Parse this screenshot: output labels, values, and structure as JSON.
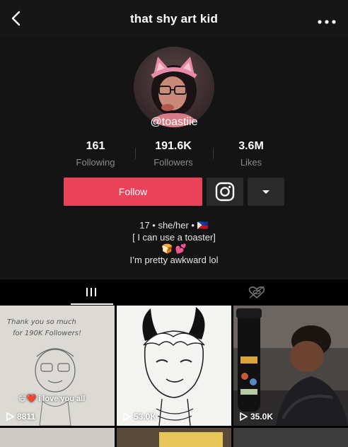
{
  "header": {
    "title": "that shy art kid"
  },
  "profile": {
    "username": "@toastiie",
    "stats": [
      {
        "value": "161",
        "label": "Following"
      },
      {
        "value": "191.6K",
        "label": "Followers"
      },
      {
        "value": "3.6M",
        "label": "Likes"
      }
    ],
    "follow_label": "Follow",
    "bio": {
      "line1": "17 • she/her • 🇵🇭",
      "line2": "[ I can use a toaster]",
      "line3": "🍞 💕",
      "line4": "I’m pretty awkward lol"
    }
  },
  "tabs": [
    {
      "name": "videos",
      "icon": "grid-icon"
    },
    {
      "name": "liked",
      "icon": "heart-hidden-icon"
    }
  ],
  "videos": [
    {
      "views": "8811",
      "caption": "😄❤️ i love you all",
      "drawn_text_1": "Thank you so much",
      "drawn_text_2": "for 190K Followers!"
    },
    {
      "views": "53.0K"
    },
    {
      "views": "35.0K"
    }
  ],
  "colors": {
    "accent": "#ea4359",
    "background": "#000000",
    "panel": "#141414"
  }
}
